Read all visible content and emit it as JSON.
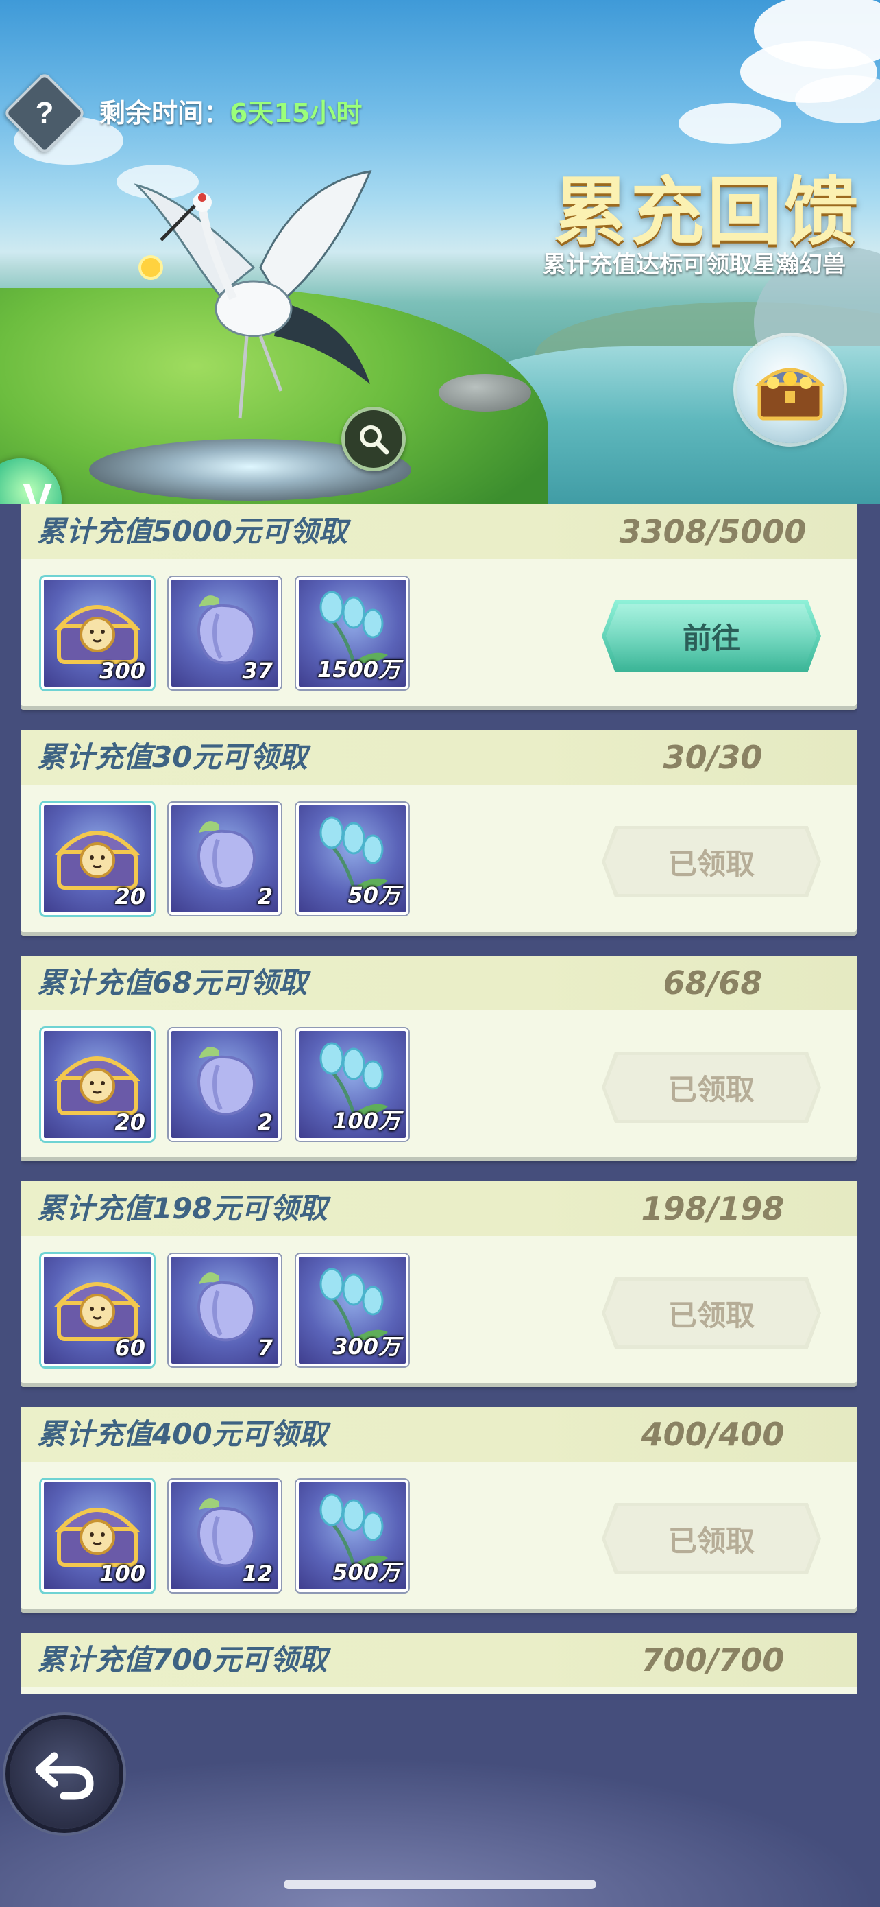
{
  "header": {
    "timer_label": "剩余时间：",
    "timer_value": "6天15小时",
    "title": "累充回馈",
    "subtitle": "累计充值达标可领取星瀚幻兽",
    "help_icon": "question-mark-icon",
    "chest_icon": "treasure-chest-icon",
    "zoom_icon": "magnifier-icon",
    "vip_icon": "vip-v-icon",
    "vip_letter": "V"
  },
  "rewards": [
    {
      "label": "累计充值5000元可领取",
      "progress": "3308/5000",
      "items": [
        {
          "icon": "chest-icon",
          "qty": "300"
        },
        {
          "icon": "fruit-icon",
          "qty": "37"
        },
        {
          "icon": "leaf-icon",
          "qty": "1500万"
        }
      ],
      "button": "前往",
      "status": "go"
    },
    {
      "label": "累计充值30元可领取",
      "progress": "30/30",
      "items": [
        {
          "icon": "chest-icon",
          "qty": "20"
        },
        {
          "icon": "fruit-icon",
          "qty": "2"
        },
        {
          "icon": "leaf-icon",
          "qty": "50万"
        }
      ],
      "button": "已领取",
      "status": "claimed"
    },
    {
      "label": "累计充值68元可领取",
      "progress": "68/68",
      "items": [
        {
          "icon": "chest-icon",
          "qty": "20"
        },
        {
          "icon": "fruit-icon",
          "qty": "2"
        },
        {
          "icon": "leaf-icon",
          "qty": "100万"
        }
      ],
      "button": "已领取",
      "status": "claimed"
    },
    {
      "label": "累计充值198元可领取",
      "progress": "198/198",
      "items": [
        {
          "icon": "chest-icon",
          "qty": "60"
        },
        {
          "icon": "fruit-icon",
          "qty": "7"
        },
        {
          "icon": "leaf-icon",
          "qty": "300万"
        }
      ],
      "button": "已领取",
      "status": "claimed"
    },
    {
      "label": "累计充值400元可领取",
      "progress": "400/400",
      "items": [
        {
          "icon": "chest-icon",
          "qty": "100"
        },
        {
          "icon": "fruit-icon",
          "qty": "12"
        },
        {
          "icon": "leaf-icon",
          "qty": "500万"
        }
      ],
      "button": "已领取",
      "status": "claimed"
    },
    {
      "label": "累计充值700元可领取",
      "progress": "700/700",
      "items": [],
      "button": "",
      "status": "partial"
    }
  ],
  "footer": {
    "back_icon": "back-arrow-icon"
  },
  "colors": {
    "go_button": "#5fd1b5",
    "timer_value": "#9bff7a",
    "label_text": "#3e6383",
    "progress_text": "#8a8263",
    "page_bg": "#454e7c"
  }
}
